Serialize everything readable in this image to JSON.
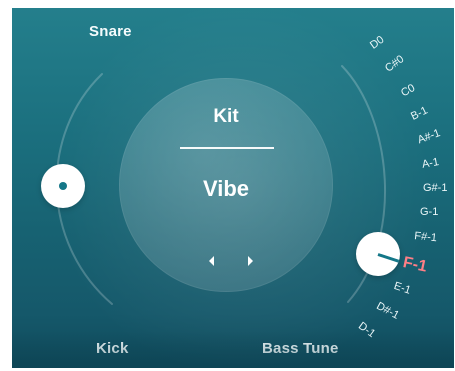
{
  "panel": {
    "snare_label": "Snare",
    "kick_label": "Kick",
    "bass_tune_label": "Bass Tune",
    "kit_title": "Kit",
    "kit_value": "Vibe"
  },
  "icons": {
    "snare_knob": "knob-icon",
    "kit_prev": "chevron-left-icon",
    "kit_next": "chevron-right-icon",
    "bass_tune_knob": "knob-icon"
  },
  "bass_tune": {
    "selected": "F-1",
    "notes": [
      "D0",
      "C#0",
      "C0",
      "B-1",
      "A#-1",
      "A-1",
      "G#-1",
      "G-1",
      "F#-1",
      "F-1",
      "E-1",
      "D#-1",
      "D-1"
    ]
  },
  "colors": {
    "panel_top": "#247f8c",
    "panel_bottom": "#0f4a5b",
    "knob_indicator": "#147788",
    "selected_note": "#ff7f86",
    "text": "#f4fbfc"
  }
}
